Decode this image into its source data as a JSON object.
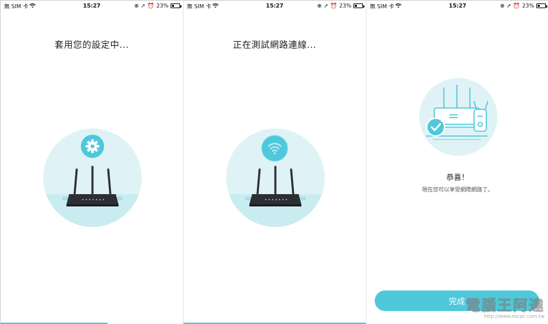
{
  "panels": [
    {
      "status": {
        "carrier": "無 SIM 卡",
        "time": "15:27",
        "battery": "23%"
      },
      "title": "套用您的設定中...",
      "badge_icon": "gear-icon"
    },
    {
      "status": {
        "carrier": "無 SIM 卡",
        "time": "15:27",
        "battery": "23%"
      },
      "title": "正在測試網路連線...",
      "badge_icon": "wifi-icon"
    },
    {
      "status": {
        "carrier": "無 SIM 卡",
        "time": "15:27",
        "battery": "23%"
      },
      "congrats": "恭喜！",
      "subtitle": "現在您可以享受網際網路了。",
      "done_label": "完成"
    }
  ],
  "battery_level": 0.23,
  "watermark": {
    "title": "電腦王阿達",
    "url": "http://www.kocpc.com.tw"
  },
  "colors": {
    "accent": "#4ec8da",
    "circle_bg": "#dff3f6",
    "router": "#2d2f33"
  }
}
